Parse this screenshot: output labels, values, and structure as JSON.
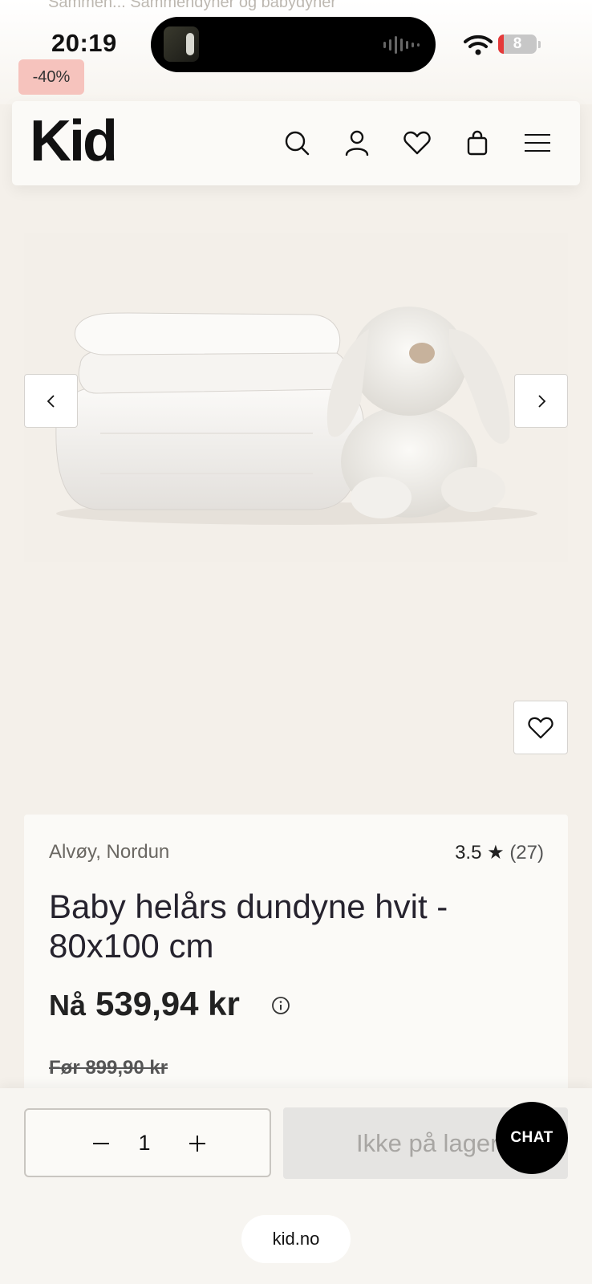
{
  "breadcrumb": {
    "text": "Sammen... Sammendyner og babydyner"
  },
  "status_bar": {
    "time": "20:19",
    "battery_level": "8",
    "battery_fraction": 0.08
  },
  "badge": {
    "discount": "-40%"
  },
  "header": {
    "logo": "Kid",
    "icons": [
      "search-icon",
      "account-icon",
      "wishlist-icon",
      "cart-icon",
      "menu-icon"
    ]
  },
  "gallery": {
    "prev_icon": "chevron-left-icon",
    "next_icon": "chevron-right-icon",
    "favorite_icon": "heart-icon"
  },
  "product": {
    "brand": "Alvøy, Nordun",
    "rating_score": "3.5",
    "rating_star": "★",
    "rating_count": "(27)",
    "title": "Baby helårs dundyne hvit - 80x100 cm",
    "price_prefix": "Nå",
    "price": "539,94 kr",
    "old_price": "Før 899,90 kr"
  },
  "purchase": {
    "quantity": "1",
    "cart_label": "Ikke på lager",
    "chat_label": "CHAT"
  },
  "browser": {
    "url": "kid.no"
  },
  "colors": {
    "accent_badge": "#f6c3bd",
    "background": "#f4f0ea",
    "button_disabled": "#e5e4e2"
  }
}
